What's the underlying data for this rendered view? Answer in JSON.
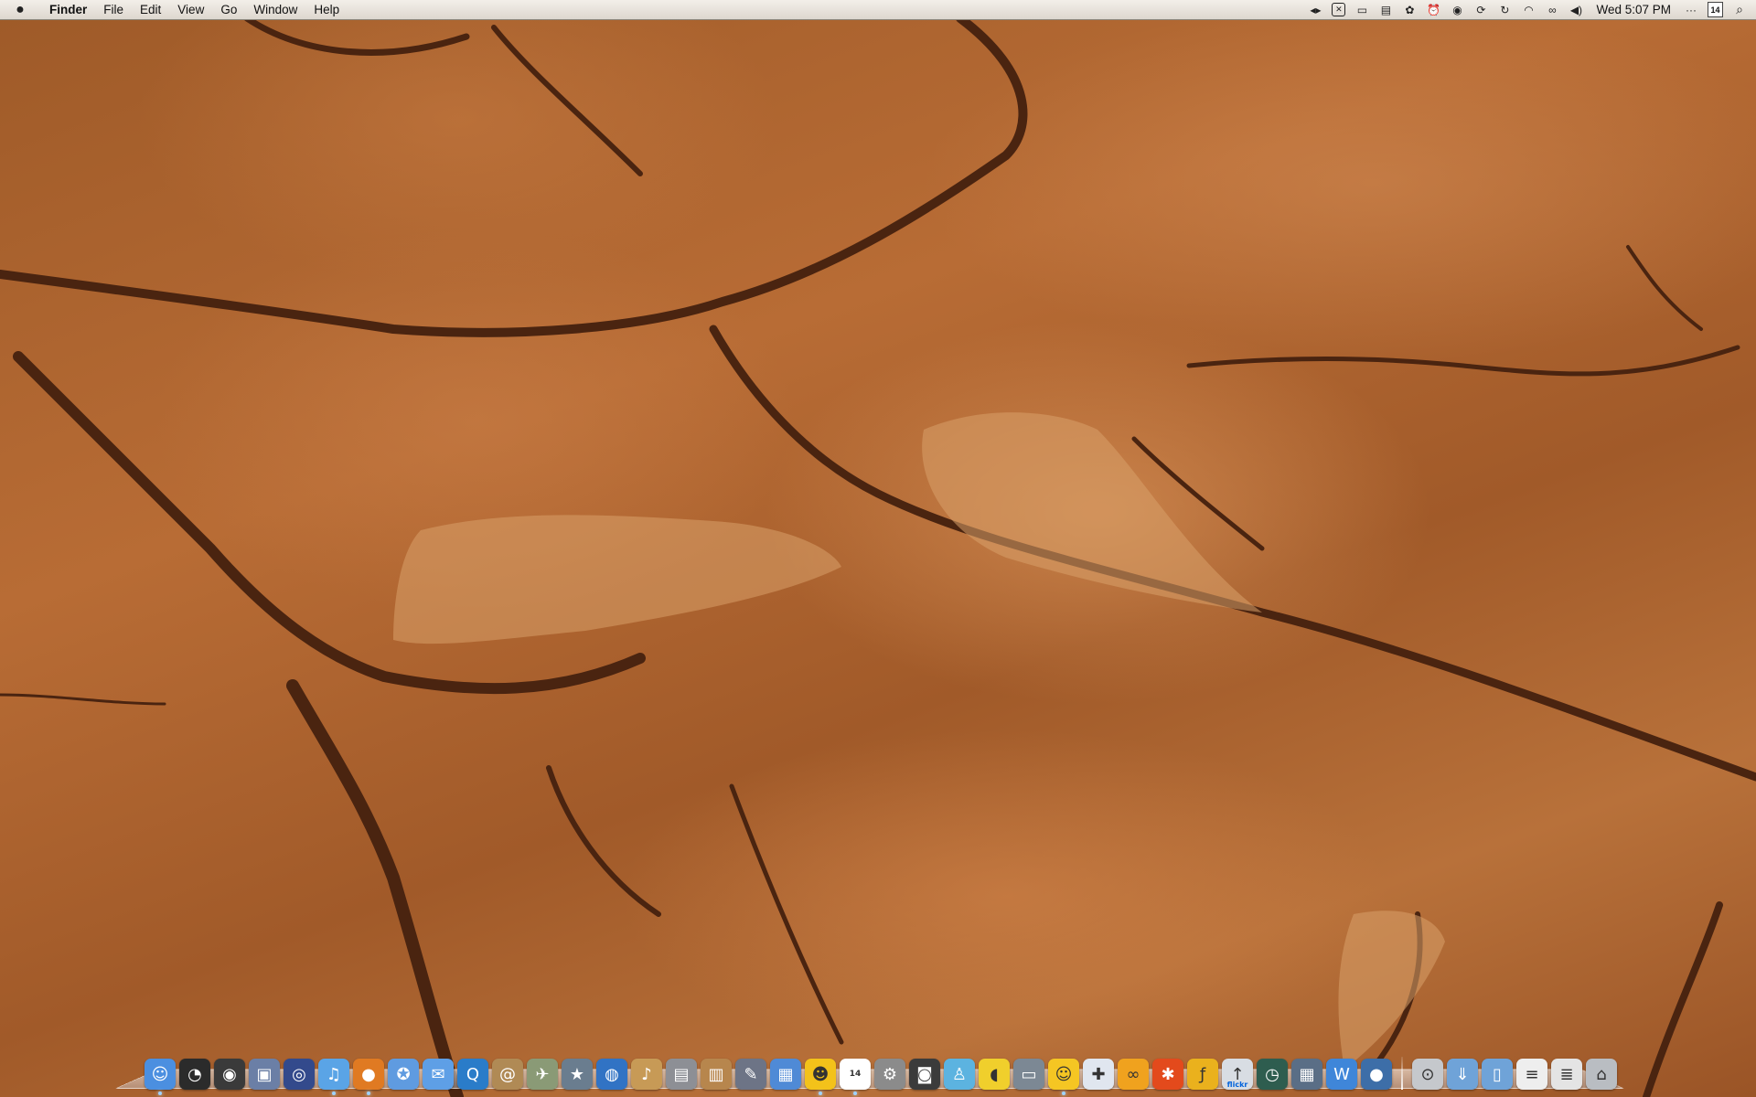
{
  "menubar": {
    "apple_icon": "apple-icon",
    "app_name": "Finder",
    "menus": [
      "File",
      "Edit",
      "View",
      "Go",
      "Window",
      "Help"
    ],
    "clock": "Wed 5:07 PM",
    "calendar_day": "14",
    "status_icons": [
      "media-controls-icon",
      "xscope-icon",
      "display-icon",
      "script-icon",
      "gear-icon",
      "alarm-clock-icon",
      "time-machine-icon",
      "sync-icon",
      "refresh-icon",
      "wifi-icon",
      "binoculars-icon",
      "volume-icon"
    ]
  },
  "dock": {
    "apps": [
      {
        "name": "finder",
        "color": "#4b8fe0",
        "glyph": "☺"
      },
      {
        "name": "dashboard",
        "color": "#2b2b2b",
        "glyph": "◔"
      },
      {
        "name": "front-row",
        "color": "#3a3a3a",
        "glyph": "◉"
      },
      {
        "name": "preview",
        "color": "#6b7fa6",
        "glyph": "▣"
      },
      {
        "name": "photo-booth",
        "color": "#334a8c",
        "glyph": "◎"
      },
      {
        "name": "itunes",
        "color": "#5aa4e6",
        "glyph": "♫"
      },
      {
        "name": "firefox",
        "color": "#e07a22",
        "glyph": "●"
      },
      {
        "name": "safari",
        "color": "#5f9be0",
        "glyph": "✪"
      },
      {
        "name": "ichat",
        "color": "#5e9fe6",
        "glyph": "✉"
      },
      {
        "name": "quicktime",
        "color": "#2a7cc9",
        "glyph": "Q"
      },
      {
        "name": "address-book",
        "color": "#b08a55",
        "glyph": "@"
      },
      {
        "name": "mail",
        "color": "#8a9a76",
        "glyph": "✈"
      },
      {
        "name": "imovie",
        "color": "#6a7d8f",
        "glyph": "★"
      },
      {
        "name": "idvd",
        "color": "#3173c4",
        "glyph": "◍"
      },
      {
        "name": "garageband",
        "color": "#c79a56",
        "glyph": "♪"
      },
      {
        "name": "iphoto",
        "color": "#8d8f95",
        "glyph": "▤"
      },
      {
        "name": "keynote",
        "color": "#b7864d",
        "glyph": "▥"
      },
      {
        "name": "pages",
        "color": "#6d7486",
        "glyph": "✎"
      },
      {
        "name": "numbers",
        "color": "#4f8ad6",
        "glyph": "▦"
      },
      {
        "name": "adium",
        "color": "#f3c21a",
        "glyph": "☻"
      },
      {
        "name": "ical",
        "color": "#ffffff",
        "glyph": "14"
      },
      {
        "name": "system-preferences",
        "color": "#8b8b8b",
        "glyph": "⚙"
      },
      {
        "name": "camera",
        "color": "#3b3b3b",
        "glyph": "◙"
      },
      {
        "name": "messenger",
        "color": "#5cb3e0",
        "glyph": "♙"
      },
      {
        "name": "cyberduck",
        "color": "#f0cf2c",
        "glyph": "◖"
      },
      {
        "name": "scanner",
        "color": "#7c8894",
        "glyph": "▭"
      },
      {
        "name": "yahoo-messenger",
        "color": "#f5c623",
        "glyph": "☺"
      },
      {
        "name": "ideas",
        "color": "#e0e6ef",
        "glyph": "✚"
      },
      {
        "name": "coda",
        "color": "#f0a21e",
        "glyph": "∞"
      },
      {
        "name": "colloquy",
        "color": "#e34a1c",
        "glyph": "✱"
      },
      {
        "name": "flash",
        "color": "#eab11d",
        "glyph": "ƒ"
      },
      {
        "name": "flickr-uploadr",
        "color": "#d8dde3",
        "glyph": "↑"
      },
      {
        "name": "time-machine",
        "color": "#2e5d4f",
        "glyph": "◷"
      },
      {
        "name": "spaces",
        "color": "#5a6e86",
        "glyph": "▦"
      },
      {
        "name": "textwrangler",
        "color": "#3f86d9",
        "glyph": "W"
      },
      {
        "name": "network-globe",
        "color": "#3d6ea8",
        "glyph": "●"
      }
    ],
    "stacks": [
      {
        "name": "disk-utility",
        "color": "#c5c8cc",
        "glyph": "⊙"
      },
      {
        "name": "downloads-folder",
        "color": "#6fa3d8",
        "glyph": "⇓"
      },
      {
        "name": "documents-folder",
        "color": "#6fa3d8",
        "glyph": "▯"
      },
      {
        "name": "document-stack",
        "color": "#eeeeee",
        "glyph": "≡"
      },
      {
        "name": "document-stack-2",
        "color": "#e4e4e4",
        "glyph": "≣"
      },
      {
        "name": "trash",
        "color": "#b9bdc2",
        "glyph": "⌂"
      }
    ],
    "flickr_label": "flickr"
  }
}
